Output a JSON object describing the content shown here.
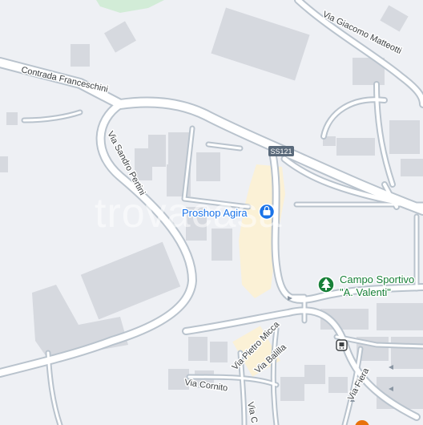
{
  "streets": {
    "via_giacomo_matteotti": "Via Giacomo Matteotti",
    "contrada_franceschini": "Contrada Franceschini",
    "via_sandro_pertini": "Via Sandro Pertini",
    "via_pietro_micca": "Via Pietro Micca",
    "via_balilla": "Via Balilla",
    "via_cornito": "Via Cornito",
    "via_fiera": "Via Fiera",
    "via_partial": "Via C"
  },
  "route_shield": {
    "label": "SS121"
  },
  "pois": {
    "proshop": {
      "name": "Proshop Agira",
      "icon": "shopping-bag-icon",
      "color": "#1a73e8"
    },
    "campo": {
      "name": "Campo Sportivo",
      "name_line2": "\"A. Valenti\"",
      "icon": "tree-icon",
      "color": "#188038"
    }
  },
  "watermark": "trovacasa",
  "colors": {
    "background": "#eef0f4",
    "road_fill": "#ffffff",
    "road_casing": "#b9c3cd",
    "building": "#d6d9df",
    "highlight_area": "#fbf1d6",
    "park": "#d2ecd7"
  }
}
